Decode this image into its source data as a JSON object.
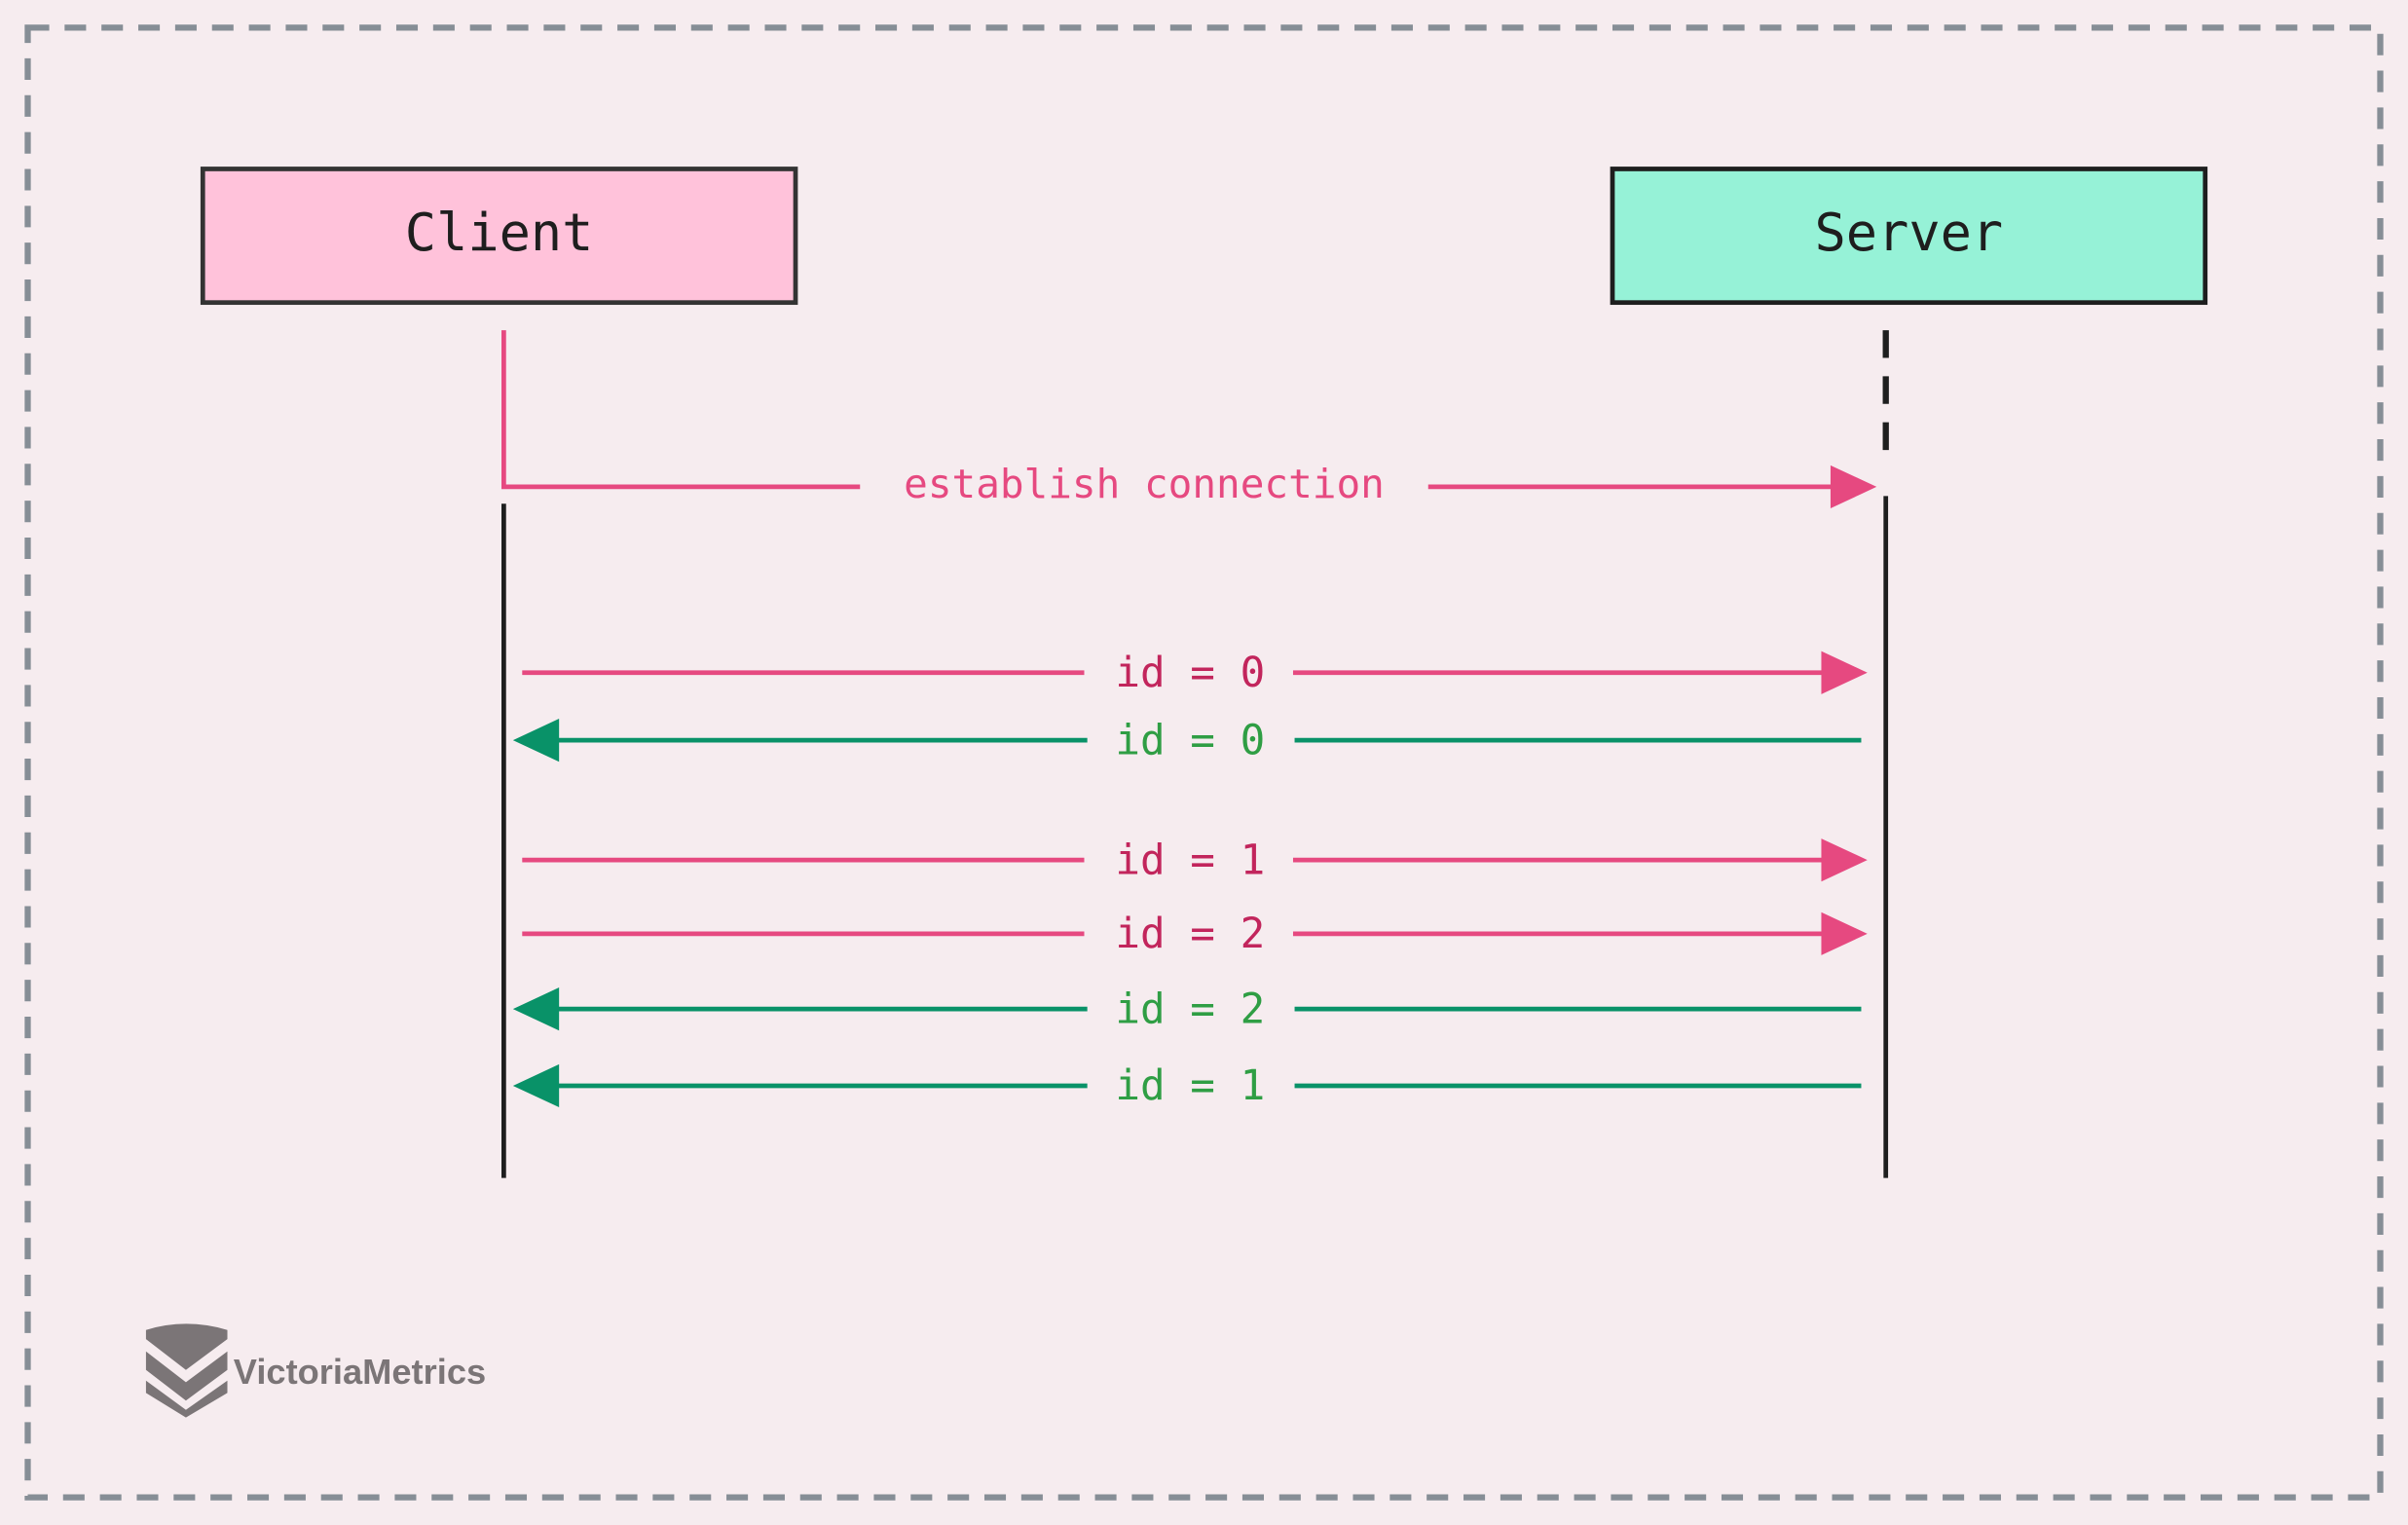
{
  "participants": {
    "client": {
      "label": "Client",
      "fill": "#ffc2da"
    },
    "server": {
      "label": "Server",
      "fill": "#96f2d7"
    }
  },
  "connection": {
    "label": "establish connection",
    "color": "#e64980"
  },
  "messages": [
    {
      "label": "id = 0",
      "direction": "client-to-server"
    },
    {
      "label": "id = 0",
      "direction": "server-to-client"
    },
    {
      "label": "id = 1",
      "direction": "client-to-server"
    },
    {
      "label": "id = 2",
      "direction": "client-to-server"
    },
    {
      "label": "id = 2",
      "direction": "server-to-client"
    },
    {
      "label": "id = 1",
      "direction": "server-to-client"
    }
  ],
  "colors": {
    "request_line": "#e64980",
    "request_text": "#c2255c",
    "response_line": "#099268",
    "response_text": "#2f9e44",
    "border": "#868e96",
    "background": "#f6ecef"
  },
  "logo": {
    "text": "VictoriaMetrics",
    "color": "#7b7577"
  }
}
